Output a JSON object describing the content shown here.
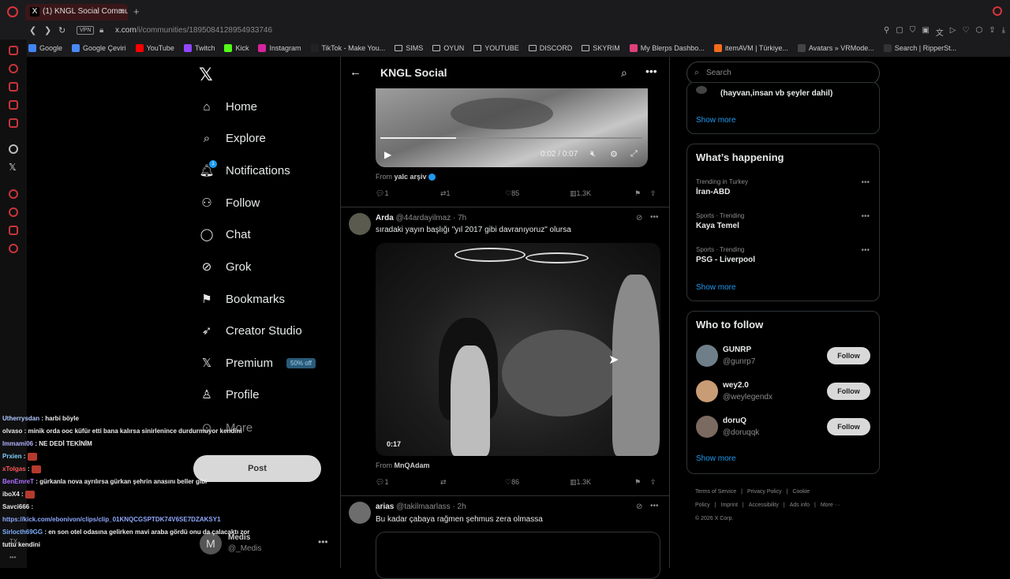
{
  "browser": {
    "tab_title": "(1) KNGL Social Communit",
    "url_host": "x.com",
    "url_path": "/i/communities/1895084128954933746",
    "vpn_label": "VPN"
  },
  "bookmarks": [
    {
      "label": "Google",
      "color": "#4285f4"
    },
    {
      "label": "Google Çeviri",
      "color": "#4a8af4"
    },
    {
      "label": "YouTube",
      "color": "#ff0000"
    },
    {
      "label": "Twitch",
      "color": "#9146ff"
    },
    {
      "label": "Kick",
      "color": "#53fc18"
    },
    {
      "label": "Instagram",
      "color": "#d6249f"
    },
    {
      "label": "TikTok - Make You...",
      "color": "#222222"
    },
    {
      "label": "SIMS",
      "color": "folder"
    },
    {
      "label": "OYUN",
      "color": "folder"
    },
    {
      "label": "YOUTUBE",
      "color": "folder"
    },
    {
      "label": "DISCORD",
      "color": "folder"
    },
    {
      "label": "SKYRIM",
      "color": "folder"
    },
    {
      "label": "My Blerps Dashbo...",
      "color": "#e0407a"
    },
    {
      "label": "itemAVM | Türkiye...",
      "color": "#f26b1d"
    },
    {
      "label": "Avatars » VRMode...",
      "color": "#444444"
    },
    {
      "label": "Search | RipperSt...",
      "color": "#333333"
    }
  ],
  "nav": {
    "items": [
      {
        "label": "Home",
        "icon": "home-icon"
      },
      {
        "label": "Explore",
        "icon": "search-icon"
      },
      {
        "label": "Notifications",
        "icon": "bell-icon"
      },
      {
        "label": "Follow",
        "icon": "person-add-icon"
      },
      {
        "label": "Chat",
        "icon": "chat-icon"
      },
      {
        "label": "Grok",
        "icon": "grok-icon"
      },
      {
        "label": "Bookmarks",
        "icon": "bookmark-icon"
      },
      {
        "label": "Creator Studio",
        "icon": "rocket-icon"
      },
      {
        "label": "Premium",
        "icon": "x-icon"
      },
      {
        "label": "Profile",
        "icon": "person-icon"
      },
      {
        "label": "More",
        "icon": "more-circle-icon"
      }
    ],
    "premium_badge": "50% off",
    "notifications_count": "1",
    "post_label": "Post",
    "account": {
      "initial": "M",
      "name": "Medis",
      "handle": "@_Medis"
    }
  },
  "chat": [
    {
      "user": "Utherrysdan",
      "color": "#b0c8ff",
      "text": " : harbi böyle"
    },
    {
      "user": "olvaso",
      "color": "#e8e8e8",
      "text": " : minik orda ooc küfür etti bana kalırsa sinirlenince durdurmuyor kendini"
    },
    {
      "user": "Immami06",
      "color": "#b0b0ff",
      "text": " : NE DEDİ TEKİNİM"
    },
    {
      "user": "Prxien",
      "color": "#7fd1ff",
      "text": " : ",
      "emote": true
    },
    {
      "user": "xTolgas",
      "color": "#ff5a5a",
      "text": " : ",
      "emote": true
    },
    {
      "user": "BenEmreT",
      "color": "#b070ff",
      "text": " : gürkanla nova ayrılırsa gürkan şehrin anasını beller gibi"
    },
    {
      "user": "iboX4",
      "color": "#e8e8e8",
      "text": " : ",
      "emote": true
    },
    {
      "user": "Savci666",
      "color": "#e8e8e8",
      "text": " :"
    },
    {
      "user": "",
      "color": "#8fa8ff",
      "text": "https://kick.com/ebonivon/clips/clip_01KNQCGSPTDK74V6SE7DZAKSY1",
      "link": true
    },
    {
      "user": "Sirlocth69GG",
      "color": "#7fb0ff",
      "text": " : en son otel odasına gelirken mavi araba gördü onu da çalacaktı zor"
    },
    {
      "user": "",
      "color": "#e8e8e8",
      "text": "tuttu kendini"
    }
  ],
  "main": {
    "title": "KNGL Social",
    "video1": {
      "time": "0:02 / 0:07",
      "progress_fraction": 0.29
    },
    "tweet1_footer": {
      "from_label": "From",
      "from_user": "yalc arşiv",
      "replies": "1",
      "reposts": "1",
      "likes": "85",
      "views": "1.3K"
    },
    "tweet2": {
      "name": "Arda",
      "handle": "@44ardayilmaz",
      "time": "· 7h",
      "text": "sıradaki yayın başlığı \"yıl 2017 gibi davranıyoruz\" olursa",
      "video_time": "0:17",
      "from_label": "From",
      "from_user": "MnQAdam",
      "replies": "1",
      "reposts": "",
      "likes": "86",
      "views": "1.3K"
    },
    "tweet3": {
      "name": "arias",
      "handle": "@takilmaarlass",
      "time": "· 2h",
      "text": "Bu kadar çabaya rağmen şehmus zera olmassa"
    }
  },
  "right": {
    "search_placeholder": "Search",
    "top_card": {
      "partial_text": "(hayvan,insan vb şeyler dahil)",
      "show_more": "Show more"
    },
    "happening": {
      "title": "What’s happening",
      "trends": [
        {
          "category": "Trending in Turkey",
          "name": "İran-ABD"
        },
        {
          "category": "Sports · Trending",
          "name": "Kaya Temel"
        },
        {
          "category": "Sports · Trending",
          "name": "PSG - Liverpool"
        }
      ],
      "show_more": "Show more"
    },
    "who_to_follow": {
      "title": "Who to follow",
      "users": [
        {
          "name": "GUNRP",
          "handle": "@gunrp7",
          "button": "Follow",
          "avatar_color": "#6f7f8a"
        },
        {
          "name": "wey2.0",
          "handle": "@weylegendx",
          "button": "Follow",
          "avatar_color": "#c89c74"
        },
        {
          "name": "doruQ",
          "handle": "@doruqqk",
          "button": "Follow",
          "avatar_color": "#7a6a60"
        }
      ],
      "show_more": "Show more"
    },
    "footer": {
      "links": [
        "Terms of Service",
        "|",
        "Privacy Policy",
        "|",
        "Cookie Policy",
        "|",
        "Imprint",
        "|",
        "Accessibility",
        "|",
        "Ads info",
        "|",
        "More ···"
      ],
      "copyright": "© 2026 X Corp."
    }
  }
}
